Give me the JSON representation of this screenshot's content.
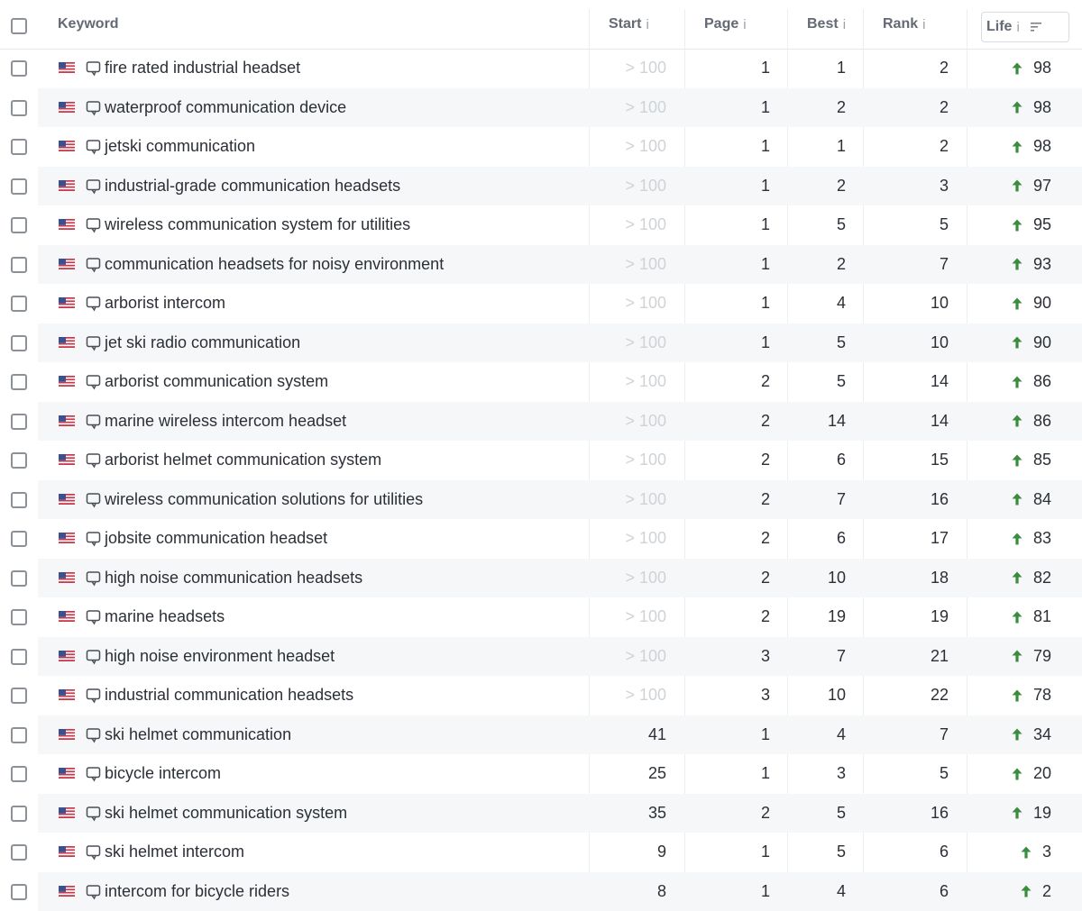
{
  "colors": {
    "up_arrow": "#3a8c3f",
    "row_alt": "#f6f7f9",
    "muted_text": "#cfd3d7",
    "header_text": "#636a73"
  },
  "icons": {
    "flag": "us-flag-icon",
    "keyword": "chat-bubble-icon",
    "trend": "arrow-up-icon",
    "sort": "sort-descending-icon"
  },
  "header": {
    "keyword": "Keyword",
    "start": "Start",
    "page": "Page",
    "best": "Best",
    "rank": "Rank",
    "life": "Life",
    "info_glyph": "i"
  },
  "rows": [
    {
      "keyword": "fire rated industrial headset",
      "start": "> 100",
      "page": "1",
      "best": "1",
      "rank": "2",
      "life": "98"
    },
    {
      "keyword": "waterproof communication device",
      "start": "> 100",
      "page": "1",
      "best": "2",
      "rank": "2",
      "life": "98"
    },
    {
      "keyword": "jetski communication",
      "start": "> 100",
      "page": "1",
      "best": "1",
      "rank": "2",
      "life": "98"
    },
    {
      "keyword": "industrial-grade communication headsets",
      "start": "> 100",
      "page": "1",
      "best": "2",
      "rank": "3",
      "life": "97"
    },
    {
      "keyword": "wireless communication system for utilities",
      "start": "> 100",
      "page": "1",
      "best": "5",
      "rank": "5",
      "life": "95"
    },
    {
      "keyword": "communication headsets for noisy environment",
      "start": "> 100",
      "page": "1",
      "best": "2",
      "rank": "7",
      "life": "93"
    },
    {
      "keyword": "arborist intercom",
      "start": "> 100",
      "page": "1",
      "best": "4",
      "rank": "10",
      "life": "90"
    },
    {
      "keyword": "jet ski radio communication",
      "start": "> 100",
      "page": "1",
      "best": "5",
      "rank": "10",
      "life": "90"
    },
    {
      "keyword": "arborist communication system",
      "start": "> 100",
      "page": "2",
      "best": "5",
      "rank": "14",
      "life": "86"
    },
    {
      "keyword": "marine wireless intercom headset",
      "start": "> 100",
      "page": "2",
      "best": "14",
      "rank": "14",
      "life": "86"
    },
    {
      "keyword": "arborist helmet communication system",
      "start": "> 100",
      "page": "2",
      "best": "6",
      "rank": "15",
      "life": "85"
    },
    {
      "keyword": "wireless communication solutions for utilities",
      "start": "> 100",
      "page": "2",
      "best": "7",
      "rank": "16",
      "life": "84"
    },
    {
      "keyword": "jobsite communication headset",
      "start": "> 100",
      "page": "2",
      "best": "6",
      "rank": "17",
      "life": "83"
    },
    {
      "keyword": "high noise communication headsets",
      "start": "> 100",
      "page": "2",
      "best": "10",
      "rank": "18",
      "life": "82"
    },
    {
      "keyword": "marine headsets",
      "start": "> 100",
      "page": "2",
      "best": "19",
      "rank": "19",
      "life": "81"
    },
    {
      "keyword": "high noise environment headset",
      "start": "> 100",
      "page": "3",
      "best": "7",
      "rank": "21",
      "life": "79"
    },
    {
      "keyword": "industrial communication headsets",
      "start": "> 100",
      "page": "3",
      "best": "10",
      "rank": "22",
      "life": "78"
    },
    {
      "keyword": "ski helmet communication",
      "start": "41",
      "page": "1",
      "best": "4",
      "rank": "7",
      "life": "34"
    },
    {
      "keyword": "bicycle intercom",
      "start": "25",
      "page": "1",
      "best": "3",
      "rank": "5",
      "life": "20"
    },
    {
      "keyword": "ski helmet communication system",
      "start": "35",
      "page": "2",
      "best": "5",
      "rank": "16",
      "life": "19"
    },
    {
      "keyword": "ski helmet intercom",
      "start": "9",
      "page": "1",
      "best": "5",
      "rank": "6",
      "life": "3"
    },
    {
      "keyword": "intercom for bicycle riders",
      "start": "8",
      "page": "1",
      "best": "4",
      "rank": "6",
      "life": "2"
    }
  ]
}
